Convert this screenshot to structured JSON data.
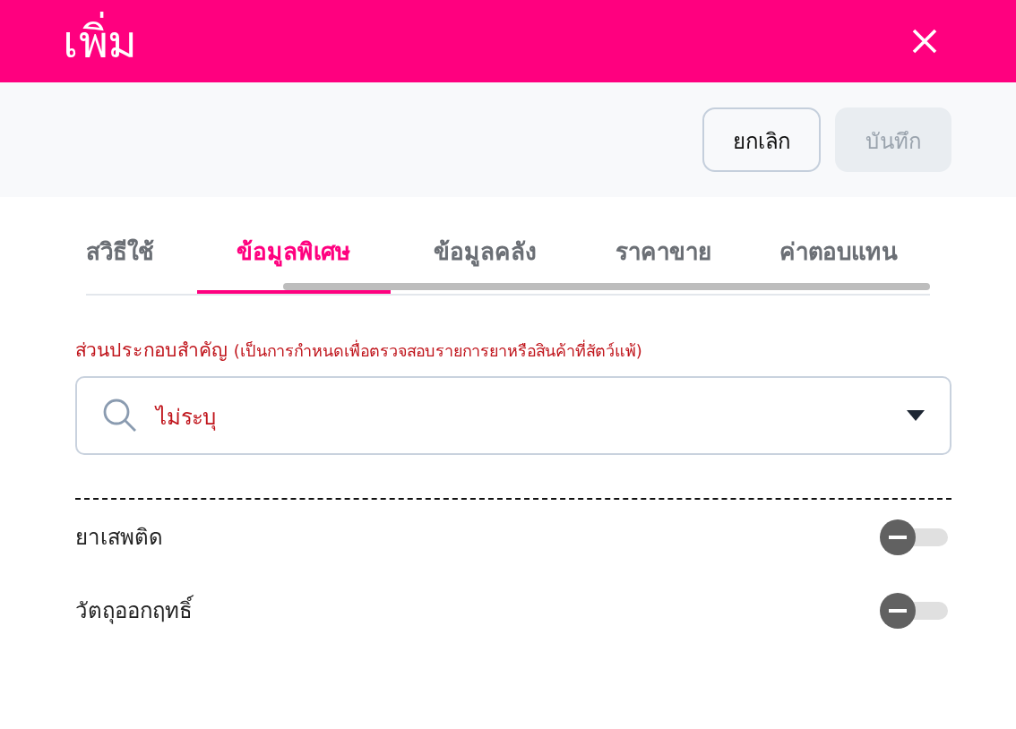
{
  "dialog": {
    "title": "เพิ่ม"
  },
  "toolbar": {
    "buttons": [
      {
        "label": "ยกเลิก",
        "disabled": false
      },
      {
        "label": "บันทึก",
        "disabled": true
      }
    ]
  },
  "tabs": [
    {
      "label": "สวิธีใช้",
      "selected": false
    },
    {
      "label": "ข้อมูลพิเศษ",
      "selected": true
    },
    {
      "label": "ข้อมูลคลัง",
      "selected": false
    },
    {
      "label": "ราคาขาย",
      "selected": false
    },
    {
      "label": "ค่าตอบแทน",
      "selected": false
    }
  ],
  "ingredient": {
    "label": "ส่วนประกอบสำคัญ",
    "note": "(เป็นการกำหนดเพื่อตรวจสอบรายการยาหรือสินค้าที่สัตว์แพ้)",
    "value": "ไม่ระบุ"
  },
  "switches": [
    {
      "label": "ยาเสพติด",
      "on": false
    },
    {
      "label": "วัตถุออกฤทธิ์",
      "on": false
    }
  ]
}
